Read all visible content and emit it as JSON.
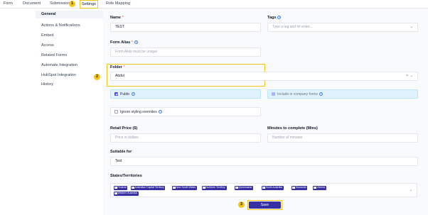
{
  "topnav": {
    "tabs": [
      {
        "label": "Form"
      },
      {
        "label": "Document"
      },
      {
        "label": "Submissions"
      },
      {
        "label": "Settings"
      },
      {
        "label": "Role Mapping"
      }
    ],
    "step_badge": "1"
  },
  "sidebar": {
    "items": [
      {
        "label": "General"
      },
      {
        "label": "Actions & Notifications"
      },
      {
        "label": "Embed"
      },
      {
        "label": "Access"
      },
      {
        "label": "Related Forms"
      },
      {
        "label": "Automate Integration"
      },
      {
        "label": "HubSpot Integration"
      },
      {
        "label": "History"
      }
    ],
    "step_badge": "2"
  },
  "form": {
    "name_label": "Name",
    "required_mark": "*",
    "name_value": "TEST",
    "tags_label": "Tags",
    "tags_placeholder": "Type a tag and hit enter...",
    "alias_label": "Form Alias",
    "alias_placeholder": "Form Alias must be unique",
    "folder_label": "Folder",
    "folder_value": "Abdul",
    "public_label": "Public",
    "public_checked": true,
    "include_company_label": "Include in company forms",
    "ignore_styling_label": "Ignore styling overrides",
    "retail_price_label": "Retail Price ($)",
    "retail_price_placeholder": "Price in dollars",
    "minutes_label": "Minutes to complete (Mins)",
    "minutes_placeholder": "Number of minutes",
    "suitable_label": "Suitable for",
    "suitable_value": "Test",
    "states_label": "States/Territories",
    "states": [
      "Federal",
      "Australian Capital Territory",
      "New South Wales",
      "Northern Territory",
      "Queensland",
      "South Australia",
      "Tasmania",
      "Victoria",
      "Western Australia"
    ],
    "save_label": "Save",
    "save_step_badge": "3"
  },
  "colors": {
    "accent": "#3730a3",
    "highlight": "#f5c518"
  }
}
